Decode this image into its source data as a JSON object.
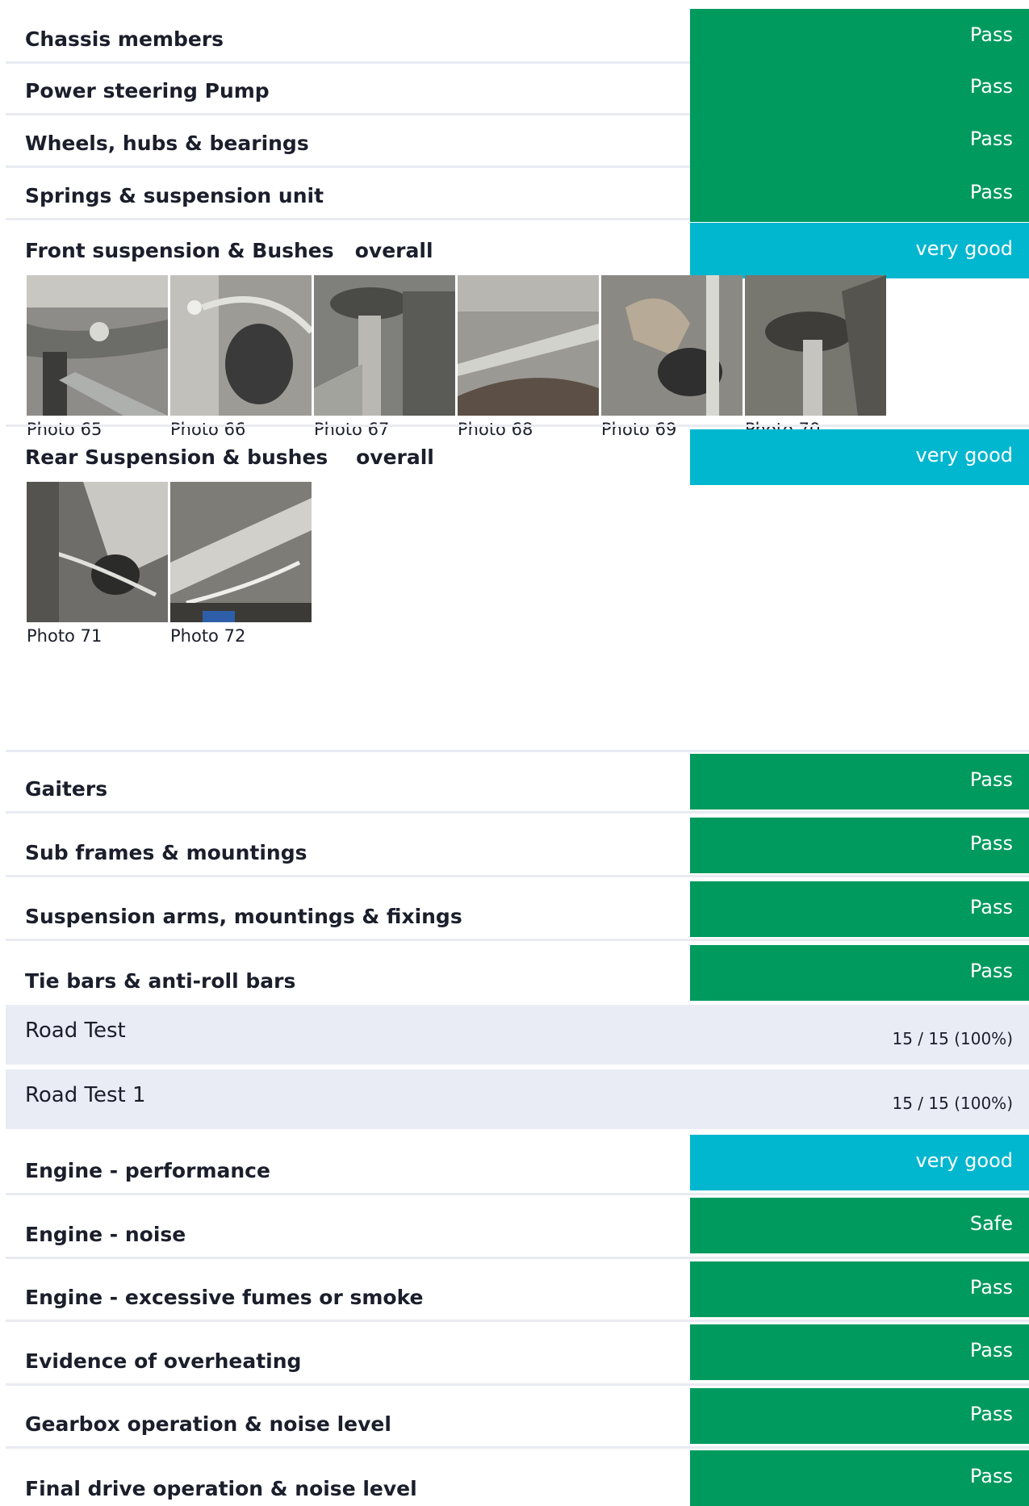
{
  "items_top": [
    {
      "label": "Chassis members",
      "status": "Pass"
    },
    {
      "label": "Power steering Pump",
      "status": "Pass"
    },
    {
      "label": "Wheels, hubs & bearings",
      "status": "Pass"
    },
    {
      "label": "Springs & suspension unit",
      "status": "Pass"
    }
  ],
  "front": {
    "label": "Front suspension & Bushes   overall",
    "status": "very good",
    "photos": [
      "Photo 65",
      "Photo 66",
      "Photo 67",
      "Photo 68",
      "Photo 69",
      "Photo 70"
    ]
  },
  "rear": {
    "label": "Rear Suspension & bushes    overall",
    "status": "very good",
    "photos": [
      "Photo 71",
      "Photo 72"
    ]
  },
  "items_mid": [
    {
      "label": "Gaiters",
      "status": "Pass"
    },
    {
      "label": "Sub frames & mountings",
      "status": "Pass"
    },
    {
      "label": "Suspension arms, mountings & fixings",
      "status": "Pass"
    },
    {
      "label": "Tie bars & anti-roll bars",
      "status": "Pass"
    }
  ],
  "sections": [
    {
      "label": "Road Test",
      "score": "15 / 15 (100%)"
    },
    {
      "label": "Road Test 1",
      "score": "15 / 15 (100%)"
    }
  ],
  "items_bottom": [
    {
      "label": "Engine - performance",
      "status": "very good"
    },
    {
      "label": "Engine - noise",
      "status": "Safe"
    },
    {
      "label": "Engine - excessive fumes or smoke",
      "status": "Pass"
    },
    {
      "label": "Evidence of overheating",
      "status": "Pass"
    },
    {
      "label": "Gearbox operation & noise level",
      "status": "Pass"
    },
    {
      "label": "Final drive operation & noise level",
      "status": "Pass"
    }
  ],
  "colors": {
    "pass": "#009a5e",
    "very_good": "#00b7cf",
    "section_bg": "#e9ecf4"
  }
}
